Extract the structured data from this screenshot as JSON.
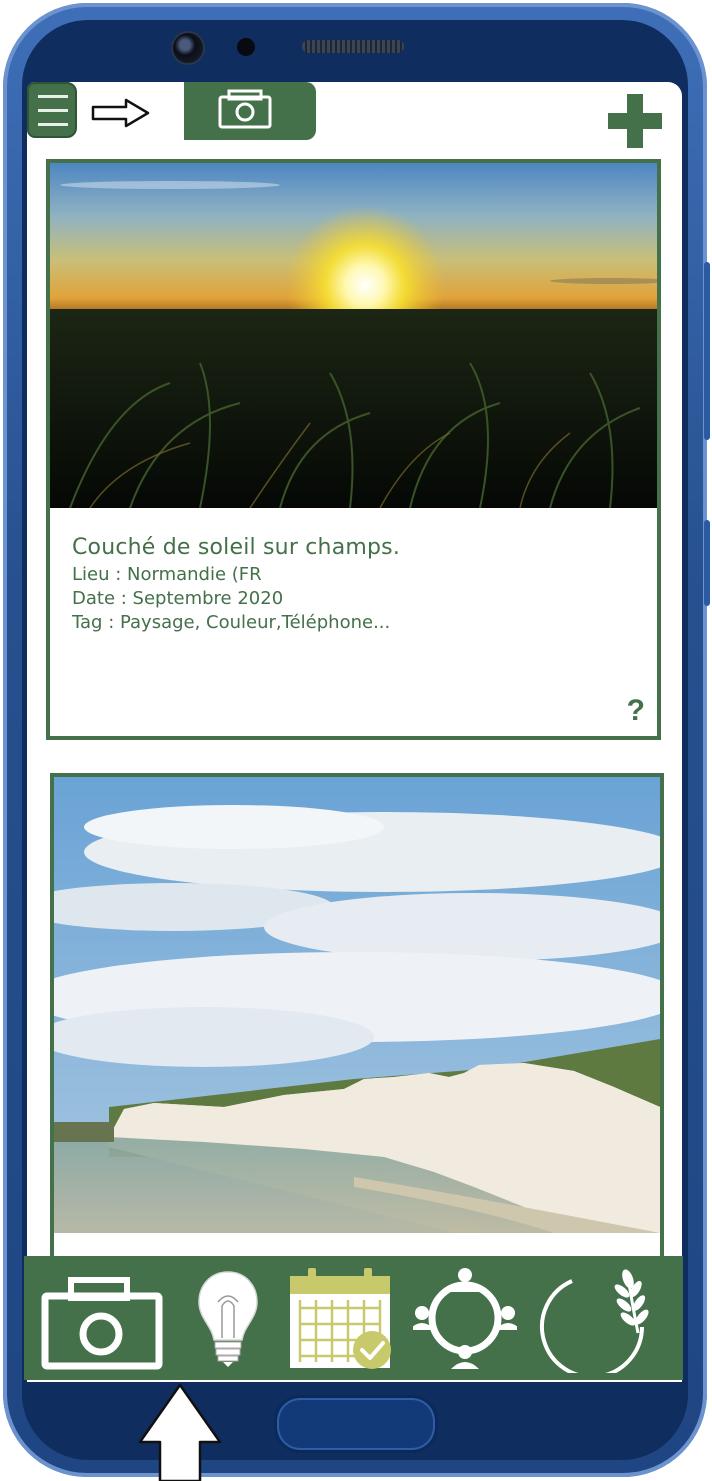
{
  "feed": {
    "cards": [
      {
        "title": "Couché de soleil sur champs.",
        "location": "Lieu : Normandie (FR",
        "date": "Date : Septembre 2020",
        "tags": "Tag : Paysage, Couleur,Téléphone...",
        "help": "?"
      },
      {
        "title": ""
      }
    ]
  },
  "icons": {
    "menu": "menu-icon",
    "arrow": "arrow-right-icon",
    "camera_tab": "camera-icon",
    "add": "plus-icon",
    "nav": [
      "camera-icon",
      "lightbulb-icon",
      "calendar-check-icon",
      "community-icon",
      "wheat-leaf-icon"
    ],
    "pointer": "arrow-up-icon"
  },
  "colors": {
    "accent": "#44704a",
    "frame": "#2b5aa0",
    "calendar": "#c8c96a"
  }
}
